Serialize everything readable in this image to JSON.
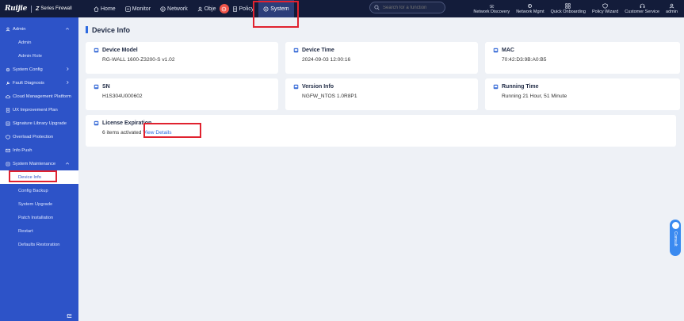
{
  "brand": {
    "logo": "Ruijie",
    "product_mark": "Z",
    "product_name": "Series Firewall"
  },
  "nav": {
    "home": "Home",
    "monitor": "Monitor",
    "network": "Network",
    "object": "Obje",
    "policy": "Policy",
    "system": "System"
  },
  "search": {
    "placeholder": "Search for a function"
  },
  "tools": {
    "network_discovery": "Network Discovery",
    "network_mgmt": "Network Mgmt",
    "quick_onboarding": "Quick Onboarding",
    "policy_wizard": "Policy Wizard",
    "customer_service": "Customer Service",
    "user": "admin"
  },
  "sidebar": {
    "admin": "Admin",
    "admin_sub": "Admin",
    "admin_role": "Admin Role",
    "system_config": "System Config",
    "fault_diagnosis": "Fault Diagnosis",
    "cloud_mgmt": "Cloud Management Platform",
    "ux_plan": "UX Improvement Plan",
    "signature_upgrade": "Signature Library Upgrade",
    "overload_protection": "Overload Protection",
    "info_push": "Info Push",
    "system_maintenance": "System Maintenance",
    "device_info": "Device Info",
    "config_backup": "Config Backup",
    "system_upgrade": "System Upgrade",
    "patch_installation": "Patch Installation",
    "restart": "Restart",
    "defaults_restoration": "Defaults Restoration"
  },
  "page": {
    "title": "Device Info"
  },
  "cards": {
    "device_model": {
      "label": "Device Model",
      "value": "RG-WALL 1600-Z3200-S v1.02"
    },
    "device_time": {
      "label": "Device Time",
      "value": "2024-09-03 12:00:16"
    },
    "mac": {
      "label": "MAC",
      "value": "70:42:D3:9B:A0:B5"
    },
    "sn": {
      "label": "SN",
      "value": "H1S304U000602"
    },
    "version_info": {
      "label": "Version Info",
      "value": "NGFW_NTOS 1.0R8P1"
    },
    "running_time": {
      "label": "Running Time",
      "value": "Running 21 Hour, 51 Minute"
    },
    "license": {
      "label": "License Expiration",
      "value": "6 items activated",
      "link": "View Details"
    }
  },
  "float_button": {
    "label": "Consult"
  },
  "colors": {
    "topbar": "#131c3a",
    "sidebar": "#2d53c8",
    "accent": "#2d6ae0",
    "highlight": "#e0222f"
  }
}
